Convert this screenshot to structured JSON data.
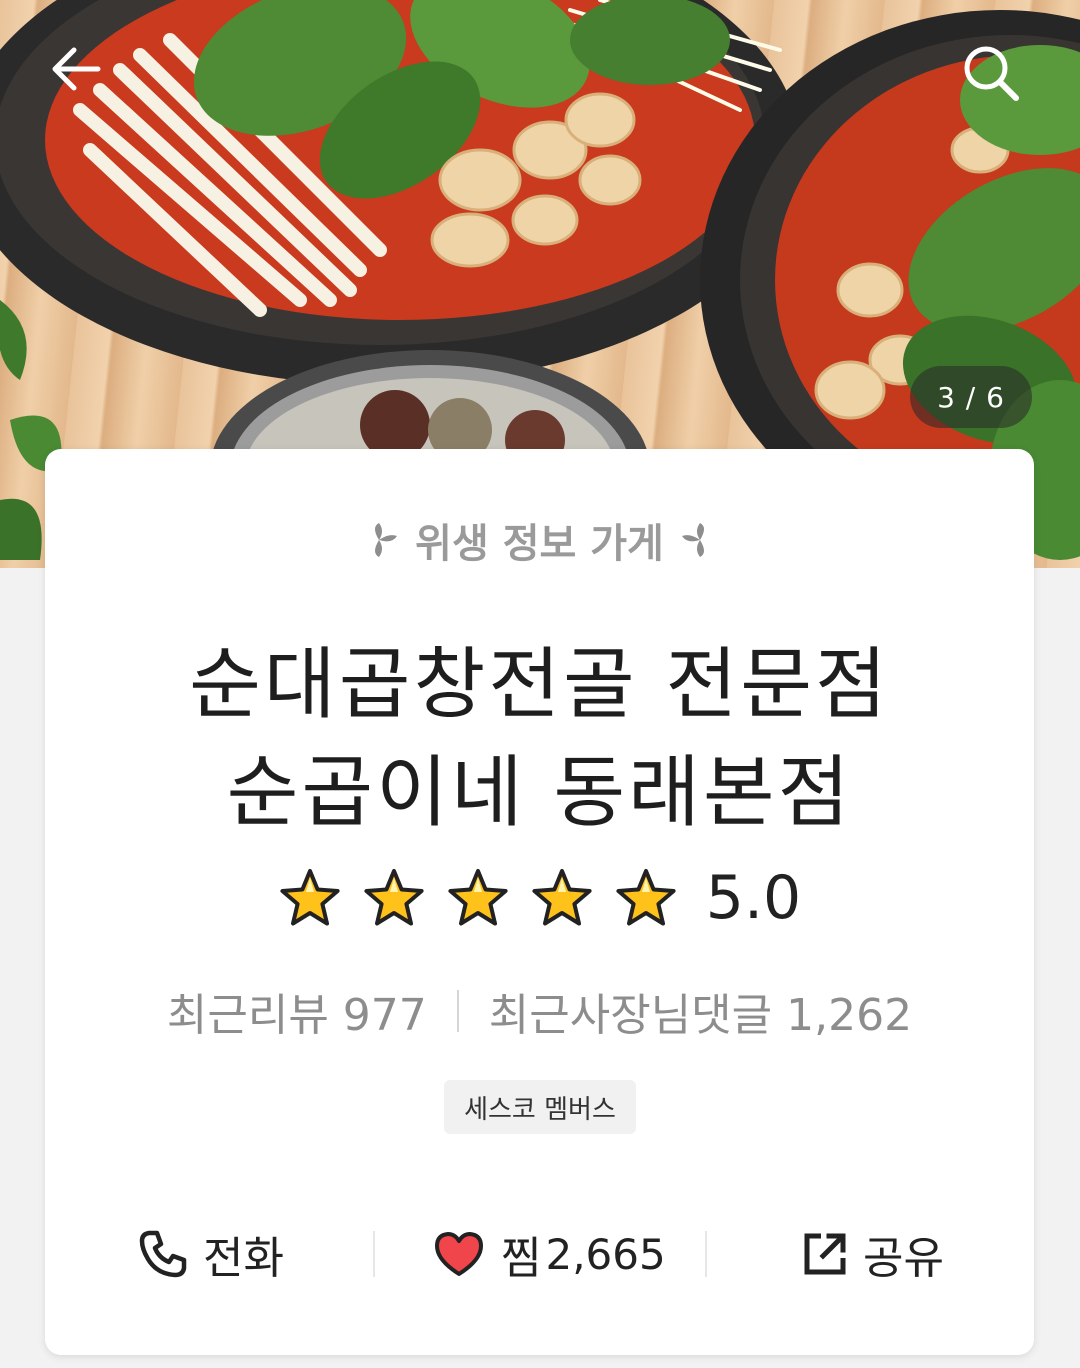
{
  "gallery": {
    "counter": "3 / 6"
  },
  "navigation": {
    "back_icon": "arrow-left-icon",
    "search_icon": "search-icon"
  },
  "store": {
    "hygiene_label": "위생 정보 가게",
    "name_line1": "순대곱창전골 전문점",
    "name_line2": "순곱이네 동래본점",
    "rating": 5.0,
    "rating_text": "5.0",
    "stars_filled": 5,
    "stars_total": 5,
    "recent_reviews_label": "최근리뷰",
    "recent_reviews_count": "977",
    "owner_replies_label": "최근사장님댓글",
    "owner_replies_count": "1,262",
    "badge": "세스코 멤버스"
  },
  "actions": {
    "call_label": "전화",
    "like_label": "찜",
    "like_count": "2,665",
    "share_label": "공유"
  },
  "colors": {
    "star_fill": "#ffc21a",
    "heart_fill": "#f0454b",
    "text_primary": "#1e1e1e",
    "text_secondary": "#8d8d8d"
  }
}
